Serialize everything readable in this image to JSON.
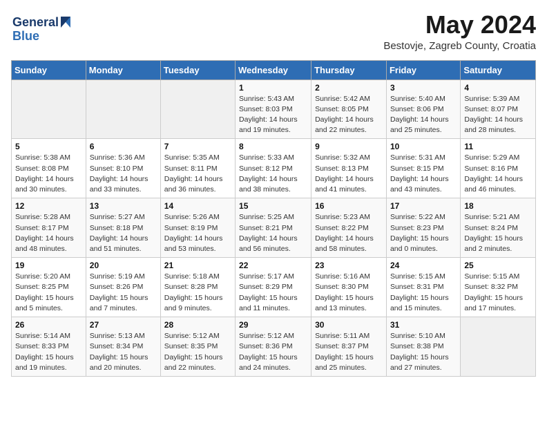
{
  "header": {
    "logo_line1": "General",
    "logo_line2": "Blue",
    "month": "May 2024",
    "location": "Bestovje, Zagreb County, Croatia"
  },
  "weekdays": [
    "Sunday",
    "Monday",
    "Tuesday",
    "Wednesday",
    "Thursday",
    "Friday",
    "Saturday"
  ],
  "weeks": [
    [
      {
        "day": "",
        "info": ""
      },
      {
        "day": "",
        "info": ""
      },
      {
        "day": "",
        "info": ""
      },
      {
        "day": "1",
        "info": "Sunrise: 5:43 AM\nSunset: 8:03 PM\nDaylight: 14 hours and 19 minutes."
      },
      {
        "day": "2",
        "info": "Sunrise: 5:42 AM\nSunset: 8:05 PM\nDaylight: 14 hours and 22 minutes."
      },
      {
        "day": "3",
        "info": "Sunrise: 5:40 AM\nSunset: 8:06 PM\nDaylight: 14 hours and 25 minutes."
      },
      {
        "day": "4",
        "info": "Sunrise: 5:39 AM\nSunset: 8:07 PM\nDaylight: 14 hours and 28 minutes."
      }
    ],
    [
      {
        "day": "5",
        "info": "Sunrise: 5:38 AM\nSunset: 8:08 PM\nDaylight: 14 hours and 30 minutes."
      },
      {
        "day": "6",
        "info": "Sunrise: 5:36 AM\nSunset: 8:10 PM\nDaylight: 14 hours and 33 minutes."
      },
      {
        "day": "7",
        "info": "Sunrise: 5:35 AM\nSunset: 8:11 PM\nDaylight: 14 hours and 36 minutes."
      },
      {
        "day": "8",
        "info": "Sunrise: 5:33 AM\nSunset: 8:12 PM\nDaylight: 14 hours and 38 minutes."
      },
      {
        "day": "9",
        "info": "Sunrise: 5:32 AM\nSunset: 8:13 PM\nDaylight: 14 hours and 41 minutes."
      },
      {
        "day": "10",
        "info": "Sunrise: 5:31 AM\nSunset: 8:15 PM\nDaylight: 14 hours and 43 minutes."
      },
      {
        "day": "11",
        "info": "Sunrise: 5:29 AM\nSunset: 8:16 PM\nDaylight: 14 hours and 46 minutes."
      }
    ],
    [
      {
        "day": "12",
        "info": "Sunrise: 5:28 AM\nSunset: 8:17 PM\nDaylight: 14 hours and 48 minutes."
      },
      {
        "day": "13",
        "info": "Sunrise: 5:27 AM\nSunset: 8:18 PM\nDaylight: 14 hours and 51 minutes."
      },
      {
        "day": "14",
        "info": "Sunrise: 5:26 AM\nSunset: 8:19 PM\nDaylight: 14 hours and 53 minutes."
      },
      {
        "day": "15",
        "info": "Sunrise: 5:25 AM\nSunset: 8:21 PM\nDaylight: 14 hours and 56 minutes."
      },
      {
        "day": "16",
        "info": "Sunrise: 5:23 AM\nSunset: 8:22 PM\nDaylight: 14 hours and 58 minutes."
      },
      {
        "day": "17",
        "info": "Sunrise: 5:22 AM\nSunset: 8:23 PM\nDaylight: 15 hours and 0 minutes."
      },
      {
        "day": "18",
        "info": "Sunrise: 5:21 AM\nSunset: 8:24 PM\nDaylight: 15 hours and 2 minutes."
      }
    ],
    [
      {
        "day": "19",
        "info": "Sunrise: 5:20 AM\nSunset: 8:25 PM\nDaylight: 15 hours and 5 minutes."
      },
      {
        "day": "20",
        "info": "Sunrise: 5:19 AM\nSunset: 8:26 PM\nDaylight: 15 hours and 7 minutes."
      },
      {
        "day": "21",
        "info": "Sunrise: 5:18 AM\nSunset: 8:28 PM\nDaylight: 15 hours and 9 minutes."
      },
      {
        "day": "22",
        "info": "Sunrise: 5:17 AM\nSunset: 8:29 PM\nDaylight: 15 hours and 11 minutes."
      },
      {
        "day": "23",
        "info": "Sunrise: 5:16 AM\nSunset: 8:30 PM\nDaylight: 15 hours and 13 minutes."
      },
      {
        "day": "24",
        "info": "Sunrise: 5:15 AM\nSunset: 8:31 PM\nDaylight: 15 hours and 15 minutes."
      },
      {
        "day": "25",
        "info": "Sunrise: 5:15 AM\nSunset: 8:32 PM\nDaylight: 15 hours and 17 minutes."
      }
    ],
    [
      {
        "day": "26",
        "info": "Sunrise: 5:14 AM\nSunset: 8:33 PM\nDaylight: 15 hours and 19 minutes."
      },
      {
        "day": "27",
        "info": "Sunrise: 5:13 AM\nSunset: 8:34 PM\nDaylight: 15 hours and 20 minutes."
      },
      {
        "day": "28",
        "info": "Sunrise: 5:12 AM\nSunset: 8:35 PM\nDaylight: 15 hours and 22 minutes."
      },
      {
        "day": "29",
        "info": "Sunrise: 5:12 AM\nSunset: 8:36 PM\nDaylight: 15 hours and 24 minutes."
      },
      {
        "day": "30",
        "info": "Sunrise: 5:11 AM\nSunset: 8:37 PM\nDaylight: 15 hours and 25 minutes."
      },
      {
        "day": "31",
        "info": "Sunrise: 5:10 AM\nSunset: 8:38 PM\nDaylight: 15 hours and 27 minutes."
      },
      {
        "day": "",
        "info": ""
      }
    ]
  ]
}
